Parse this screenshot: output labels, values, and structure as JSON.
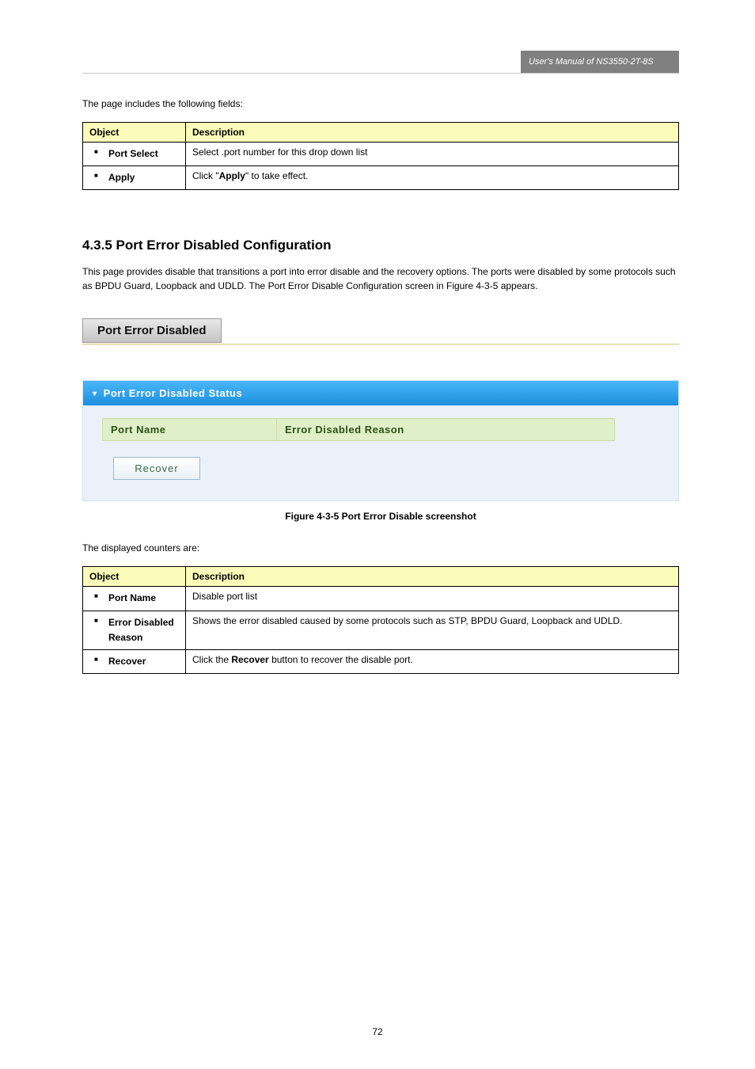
{
  "header": {
    "manual_title": "User's Manual of NS3550-2T-8S"
  },
  "intro_text": "The page includes the following fields:",
  "table1": {
    "head_obj": "Object",
    "head_desc": "Description",
    "rows": [
      {
        "obj": "Port Select",
        "desc": "Select .port number for this drop down list"
      },
      {
        "obj": "Apply",
        "desc": "Click \"Apply\" to take effect."
      }
    ]
  },
  "section": {
    "number": "4.3.5",
    "title": "Port Error Disabled Configuration",
    "para": "This page provides disable that transitions a port into error disable and the recovery options. The ports were disabled by some protocols such as BPDU Guard, Loopback and UDLD. The Port Error Disable Configuration screen in Figure 4-3-5 appears."
  },
  "ui": {
    "tab_label": "Port Error Disabled",
    "panel_title": "Port Error Disabled Status",
    "columns": {
      "port": "Port Name",
      "reason": "Error Disabled Reason"
    },
    "recover_label": "Recover"
  },
  "figure": {
    "label": "Figure 4-3-5",
    "caption": "Port Error Disable screenshot"
  },
  "table2": {
    "intro": "The displayed counters are:",
    "head_obj": "Object",
    "head_desc": "Description",
    "rows": [
      {
        "obj": "Port Name",
        "desc": "Disable port list"
      },
      {
        "obj": "Error Disabled Reason",
        "desc": "Shows the error disabled caused by some protocols such as STP, BPDU Guard, Loopback and UDLD.",
        "desc_bold_prefix": "Error Disabled Reason"
      },
      {
        "obj": "Recover",
        "desc": "Click the Recover button to recover the disable port."
      }
    ]
  },
  "page_number": "72"
}
